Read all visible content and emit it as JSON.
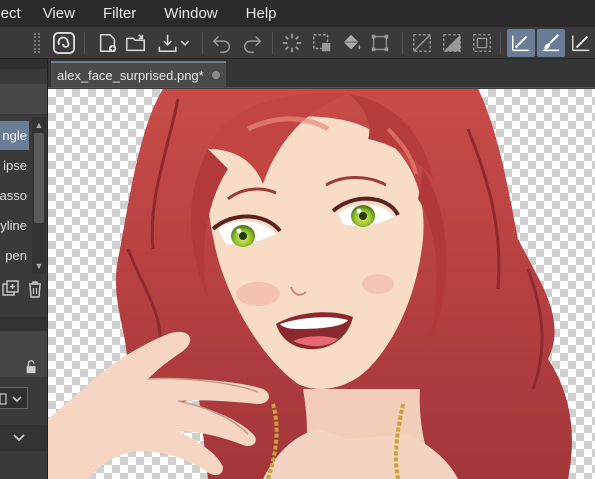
{
  "menu": {
    "items": [
      "elect",
      "View",
      "Filter",
      "Window",
      "Help"
    ]
  },
  "toolbar": {
    "buttons": [
      "app-logo-icon",
      "new-file-icon",
      "open-folder-icon",
      "save-icon",
      "undo-icon",
      "redo-icon",
      "selection-spinner-icon",
      "selection-marquee-icon",
      "fill-bucket-icon",
      "transform-icon",
      "clear-icon",
      "invert-icon",
      "frame-icon",
      "pen-check-icon",
      "brush-icon",
      "ruler-pen-icon"
    ],
    "active": [
      "pen-check-icon",
      "brush-icon"
    ],
    "accent": "#6b7d96"
  },
  "left_panel": {
    "tools": [
      "ngle",
      "ipse",
      "asso",
      "yline",
      "pen"
    ],
    "selected_tool": "ngle"
  },
  "document": {
    "tab_label": "alex_face_surprised.png*"
  },
  "canvas": {
    "background": "transparency-checkerboard",
    "artwork": "illustration-red-haired-girl-smiling"
  }
}
